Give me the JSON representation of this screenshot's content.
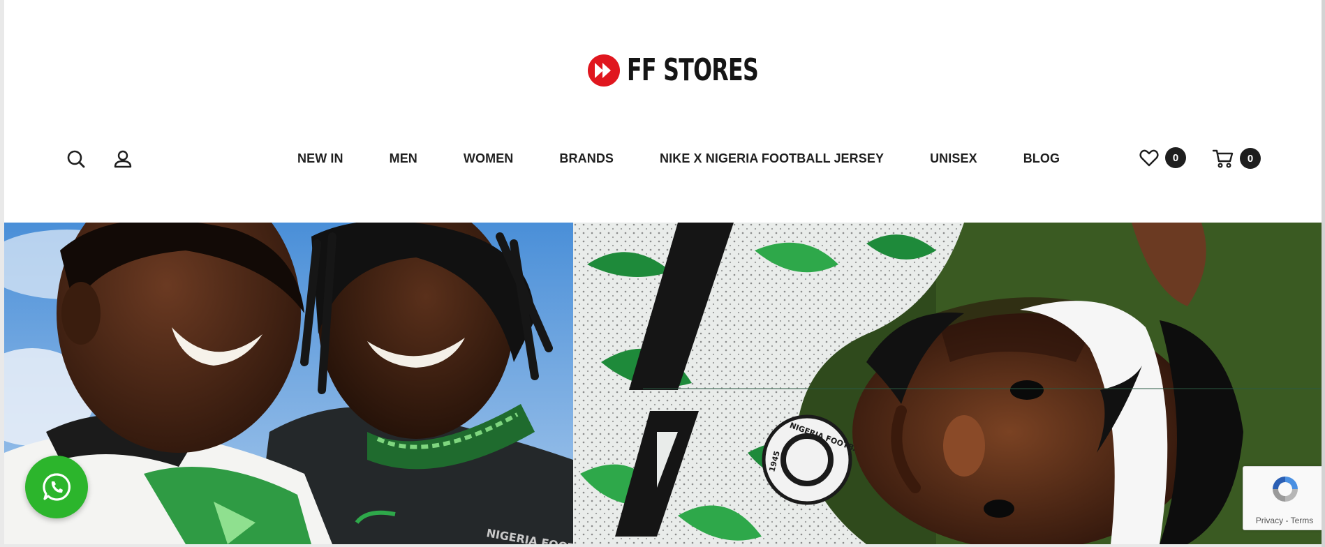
{
  "brand": {
    "name": "FF STORES",
    "accent_color": "#e0161e"
  },
  "header": {
    "search_icon": "search-icon",
    "account_icon": "user-icon",
    "menu": [
      {
        "label": "NEW IN"
      },
      {
        "label": "MEN"
      },
      {
        "label": "WOMEN"
      },
      {
        "label": "BRANDS"
      },
      {
        "label": "NIKE X NIGERIA FOOTBALL JERSEY"
      },
      {
        "label": "UNISEX"
      },
      {
        "label": "BLOG"
      }
    ],
    "wishlist": {
      "icon": "heart-icon",
      "count": "0"
    },
    "cart": {
      "icon": "cart-icon",
      "count": "0"
    }
  },
  "hero": {
    "jersey_badge_text": "NIGERIA FOOTBALL FEDERATION",
    "jersey_badge_year": "1945",
    "left_jersey_text": "NIGERIA FOOTBALL FED"
  },
  "floating": {
    "whatsapp_icon": "whatsapp-icon",
    "recaptcha": {
      "privacy": "Privacy",
      "separator": " - ",
      "terms": "Terms"
    }
  }
}
